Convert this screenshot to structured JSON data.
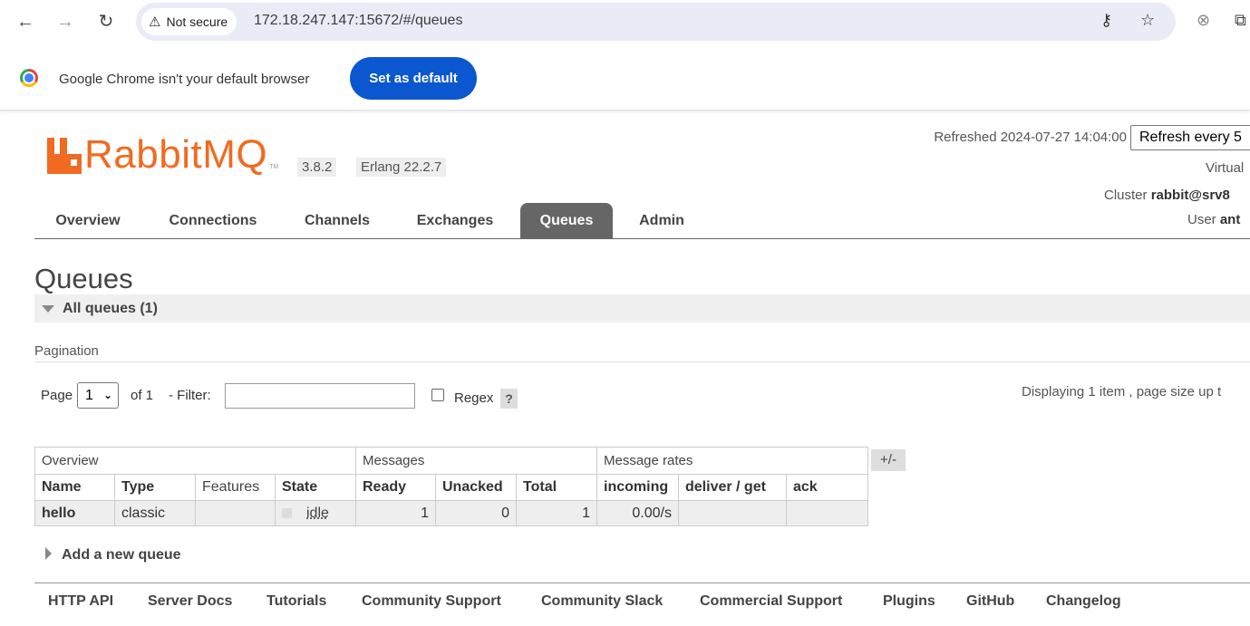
{
  "browser": {
    "security_label": "Not secure",
    "url": "172.18.247.147:15672/#/queues",
    "infobar_text": "Google Chrome isn't your default browser",
    "set_default_label": "Set as default"
  },
  "header": {
    "logo_text": "RabbitMQ",
    "logo_tm": "TM",
    "version": "3.8.2",
    "erlang": "Erlang 22.2.7",
    "refreshed": "Refreshed 2024-07-27 14:04:00",
    "refresh_select": "Refresh every 5",
    "virtual_label": "Virtual",
    "cluster_label": "Cluster",
    "cluster_value": "rabbit@srv8",
    "user_label": "User",
    "user_value": "ant"
  },
  "tabs": [
    {
      "label": "Overview"
    },
    {
      "label": "Connections"
    },
    {
      "label": "Channels"
    },
    {
      "label": "Exchanges"
    },
    {
      "label": "Queues",
      "active": true
    },
    {
      "label": "Admin"
    }
  ],
  "main": {
    "title": "Queues",
    "section_label": "All queues (1)",
    "pagination_label": "Pagination",
    "page_label": "Page",
    "page_value": "1",
    "of_label": "of 1",
    "filter_label": "- Filter:",
    "regex_label": "Regex",
    "help_label": "?",
    "displaying": "Displaying 1 item , page size up t"
  },
  "table": {
    "groups": [
      "Overview",
      "Messages",
      "Message rates"
    ],
    "columns": [
      "Name",
      "Type",
      "Features",
      "State",
      "Ready",
      "Unacked",
      "Total",
      "incoming",
      "deliver / get",
      "ack"
    ],
    "rows": [
      {
        "name": "hello",
        "type": "classic",
        "features": "",
        "state": "idle",
        "ready": "1",
        "unacked": "0",
        "total": "1",
        "incoming": "0.00/s",
        "deliver_get": "",
        "ack": ""
      }
    ],
    "toggle_label": "+/-"
  },
  "add_queue_label": "Add a new queue",
  "footer": [
    "HTTP API",
    "Server Docs",
    "Tutorials",
    "Community Support",
    "Community Slack",
    "Commercial Support",
    "Plugins",
    "GitHub",
    "Changelog"
  ],
  "colors": {
    "brand": "#f06b21",
    "active_tab": "#666666",
    "chrome_button": "#0b57d0"
  }
}
